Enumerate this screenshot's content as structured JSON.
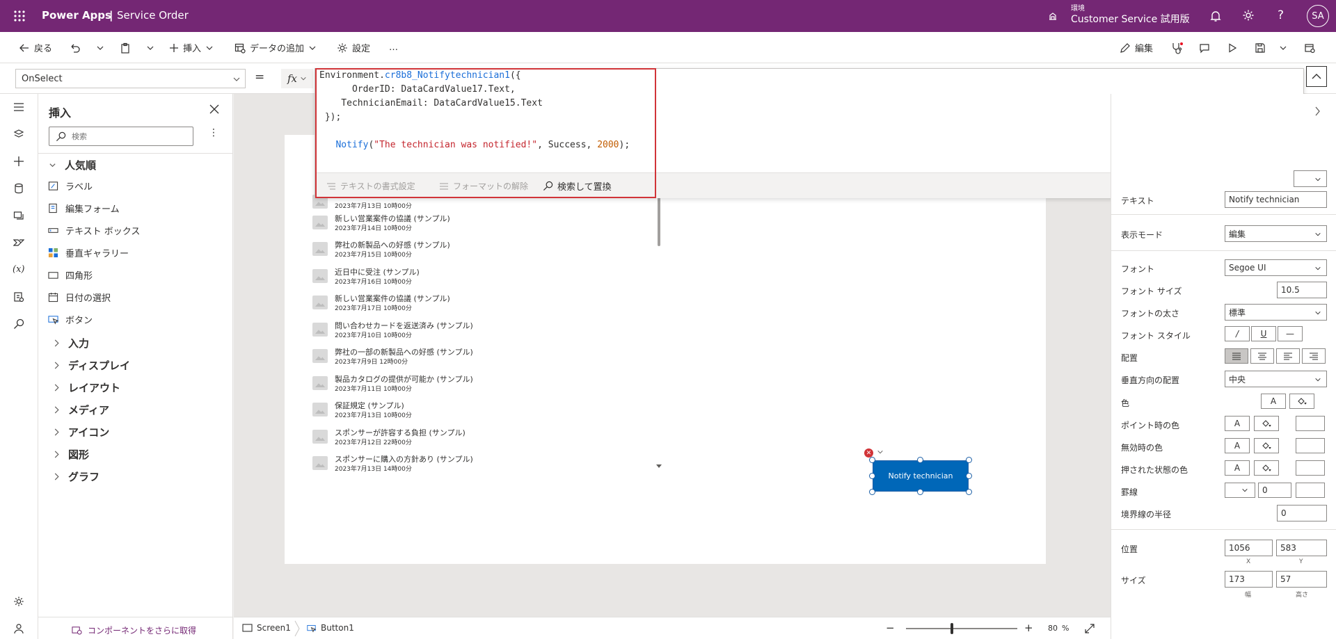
{
  "header": {
    "app_name": "Power Apps",
    "separator": "|",
    "app_title": "Service Order",
    "env_label": "環境",
    "env_name": "Customer Service 試用版",
    "avatar": "SA"
  },
  "toolbar": {
    "back": "戻る",
    "insert": "挿入",
    "add_data": "データの追加",
    "settings": "設定",
    "more": "…",
    "edit": "編集"
  },
  "formula": {
    "property": "OnSelect",
    "equals": "=",
    "fx": "fx",
    "line1_a": "Environment.",
    "line1_b": "cr8b8_Notifytechnician1",
    "line1_c": "({",
    "line2": "      OrderID: DataCardValue17.Text,",
    "line3": "    TechnicianEmail: DataCardValue15.Text",
    "line4": " });",
    "line6_a": "Notify",
    "line6_b": "(",
    "line6_c": "\"The technician was notified!\"",
    "line6_d": ", Success, ",
    "line6_e": "2000",
    "line6_f": ");",
    "tool_format": "テキストの書式設定",
    "tool_clear": "フォーマットの解除",
    "tool_find": "検索して置換"
  },
  "insert_panel": {
    "title": "挿入",
    "search_placeholder": "検索",
    "popular": "人気順",
    "items": [
      {
        "label": "ラベル"
      },
      {
        "label": "編集フォーム"
      },
      {
        "label": "テキスト ボックス"
      },
      {
        "label": "垂直ギャラリー"
      },
      {
        "label": "四角形"
      },
      {
        "label": "日付の選択"
      },
      {
        "label": "ボタン"
      }
    ],
    "groups": [
      {
        "label": "入力"
      },
      {
        "label": "ディスプレイ"
      },
      {
        "label": "レイアウト"
      },
      {
        "label": "メディア"
      },
      {
        "label": "アイコン"
      },
      {
        "label": "図形"
      },
      {
        "label": "グラフ"
      }
    ],
    "get_more": "コンポーネントをさらに取得"
  },
  "gallery": {
    "items": [
      {
        "title": "",
        "sub": "2023年7月13日 10時00分"
      },
      {
        "title": "新しい営業案件の協議 (サンプル)",
        "sub": "2023年7月14日 10時00分"
      },
      {
        "title": "弊社の新製品への好感 (サンプル)",
        "sub": "2023年7月15日 10時00分"
      },
      {
        "title": "近日中に受注 (サンプル)",
        "sub": "2023年7月16日 10時00分"
      },
      {
        "title": "新しい営業案件の協議 (サンプル)",
        "sub": "2023年7月17日 10時00分"
      },
      {
        "title": "問い合わせカードを返送済み (サンプル)",
        "sub": "2023年7月10日 10時00分"
      },
      {
        "title": "弊社の一部の新製品への好感 (サンプル)",
        "sub": "2023年7月9日 12時00分"
      },
      {
        "title": "製品カタログの提供が可能か (サンプル)",
        "sub": "2023年7月11日 10時00分"
      },
      {
        "title": "保証規定 (サンプル)",
        "sub": "2023年7月13日 10時00分"
      },
      {
        "title": "スポンサーが許容する負担 (サンプル)",
        "sub": "2023年7月12日 22時00分"
      },
      {
        "title": "スポンサーに購入の方針あり (サンプル)",
        "sub": "2023年7月13日 14時00分"
      }
    ]
  },
  "button": {
    "label": "Notify technician"
  },
  "props": {
    "text_label": "テキスト",
    "text_value": "Notify technician",
    "display_mode_label": "表示モード",
    "display_mode_value": "編集",
    "font_label": "フォント",
    "font_value": "Segoe UI",
    "font_size_label": "フォント サイズ",
    "font_size_value": "10.5",
    "font_weight_label": "フォントの太さ",
    "font_weight_value": "標準",
    "font_style_label": "フォント スタイル",
    "align_label": "配置",
    "valign_label": "垂直方向の配置",
    "valign_value": "中央",
    "color_label": "色",
    "hover_label": "ポイント時の色",
    "disabled_label": "無効時の色",
    "pressed_label": "押された状態の色",
    "border_label": "罫線",
    "border_value": "0",
    "radius_label": "境界線の半径",
    "radius_value": "0",
    "position_label": "位置",
    "pos_x": "1056",
    "pos_y": "583",
    "x_label": "X",
    "y_label": "Y",
    "size_label": "サイズ",
    "width": "173",
    "height": "57",
    "w_label": "幅",
    "h_label": "高さ",
    "italic": "/",
    "underline": "U",
    "strike": "—",
    "A": "A"
  },
  "bottom": {
    "screen": "Screen1",
    "button": "Button1",
    "zoom": "80",
    "percent": "%",
    "minus": "−",
    "plus": "+"
  }
}
